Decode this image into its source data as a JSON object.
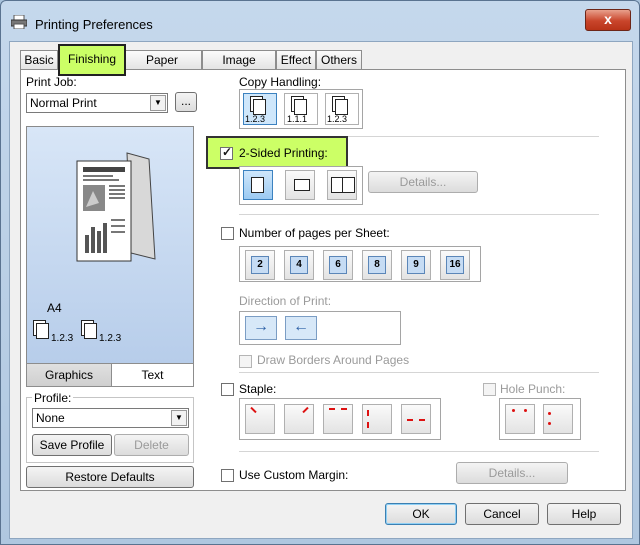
{
  "window": {
    "title": "Printing Preferences",
    "close_label": "x"
  },
  "tabs": [
    {
      "label": "Basic"
    },
    {
      "label": "Finishing"
    },
    {
      "label": "Paper Handling"
    },
    {
      "label": "Image Quality"
    },
    {
      "label": "Effect"
    },
    {
      "label": "Others"
    }
  ],
  "active_tab": "Finishing",
  "left": {
    "print_job_label": "Print Job:",
    "print_job_value": "Normal Print",
    "print_job_more": "...",
    "preview": {
      "paper": "A4",
      "stack1": "1.2.3",
      "stack2": "1.2.3"
    },
    "seg_graphics": "Graphics",
    "seg_text": "Text",
    "profile_label": "Profile:",
    "profile_value": "None",
    "save_profile": "Save Profile",
    "delete": "Delete",
    "restore_defaults": "Restore Defaults"
  },
  "right": {
    "copy_handling_label": "Copy Handling:",
    "copy_options": [
      "1.2.3",
      "1.1.1",
      "1.2.3"
    ],
    "two_sided_label": "2-Sided Printing:",
    "two_sided_checked": true,
    "two_sided_details": "Details...",
    "pages_per_sheet_label": "Number of pages per Sheet:",
    "pages_per_sheet_checked": false,
    "pages_options": [
      "2",
      "4",
      "6",
      "8",
      "9",
      "16"
    ],
    "direction_label": "Direction of Print:",
    "draw_borders_label": "Draw Borders Around Pages",
    "staple_label": "Staple:",
    "hole_punch_label": "Hole Punch:",
    "custom_margin_label": "Use Custom Margin:",
    "custom_margin_details": "Details..."
  },
  "footer": {
    "ok": "OK",
    "cancel": "Cancel",
    "help": "Help"
  },
  "colors": {
    "highlight": "#ccff66",
    "selected_icon": "#9ccaf2"
  }
}
